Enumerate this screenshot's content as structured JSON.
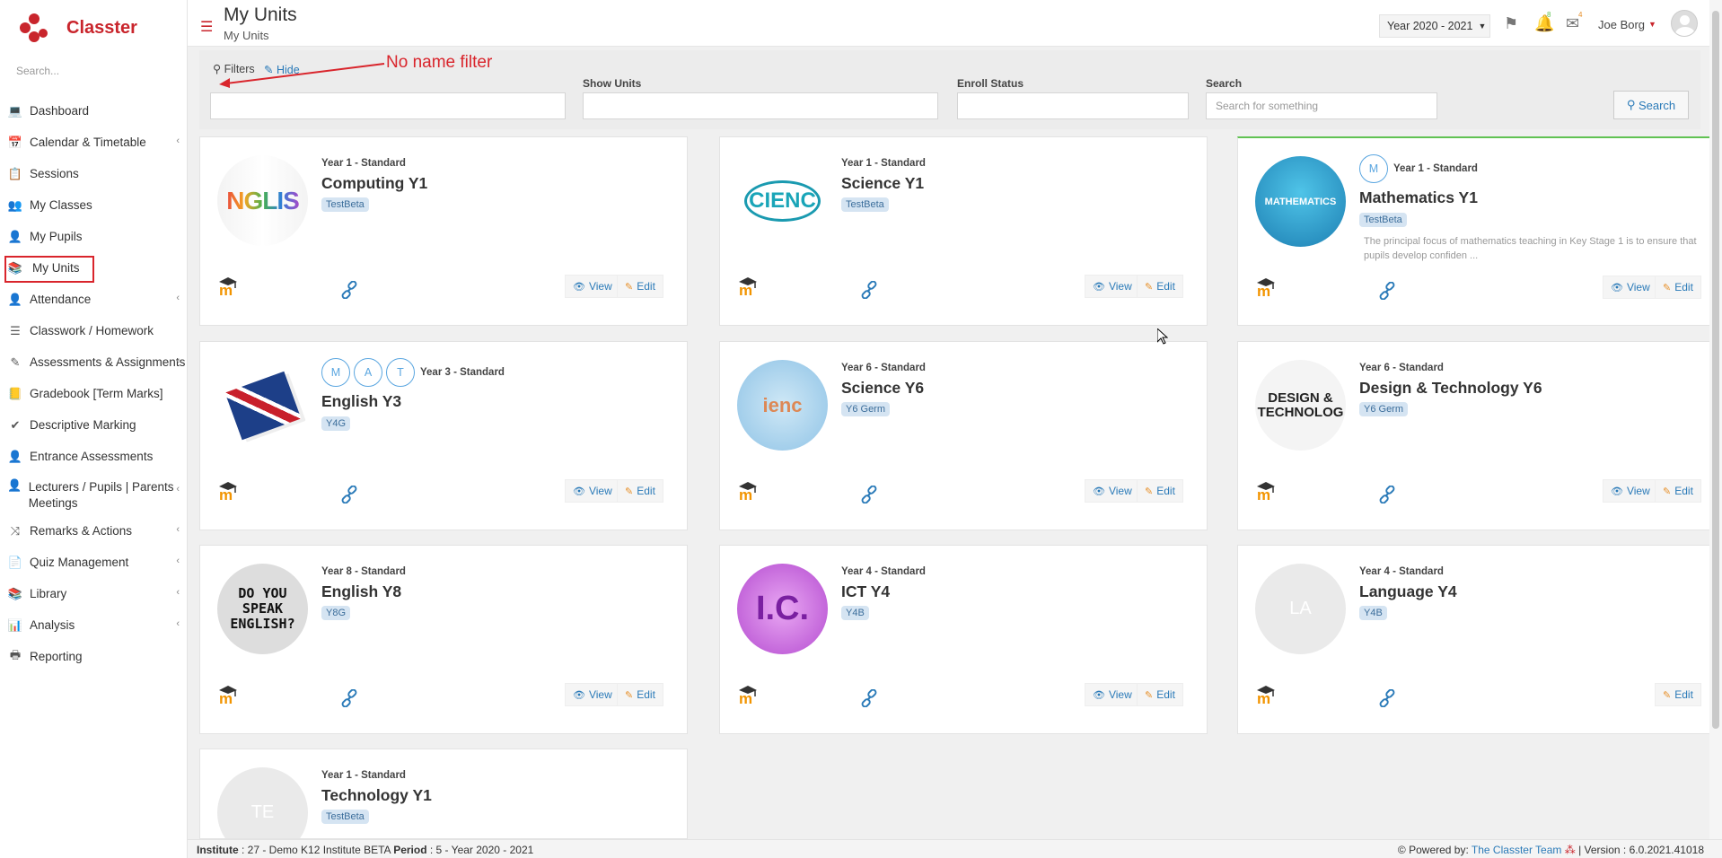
{
  "app": {
    "name": "Classter"
  },
  "sidebar": {
    "search_placeholder": "Search...",
    "items": [
      {
        "label": "Dashboard",
        "icon": "laptop-icon",
        "glyph": "💻",
        "has_arrow": false
      },
      {
        "label": "Calendar & Timetable",
        "icon": "calendar-icon",
        "glyph": "📅",
        "has_arrow": true
      },
      {
        "label": "Sessions",
        "icon": "sessions-icon",
        "glyph": "📋",
        "has_arrow": false
      },
      {
        "label": "My Classes",
        "icon": "classes-icon",
        "glyph": "👥",
        "has_arrow": false
      },
      {
        "label": "My Pupils",
        "icon": "pupils-icon",
        "glyph": "👤",
        "has_arrow": false
      },
      {
        "label": "My Units",
        "icon": "units-icon",
        "glyph": "📚",
        "has_arrow": false,
        "active": true
      },
      {
        "label": "Attendance",
        "icon": "attendance-icon",
        "glyph": "👤",
        "has_arrow": true
      },
      {
        "label": "Classwork / Homework",
        "icon": "list-icon",
        "glyph": "☰",
        "has_arrow": false
      },
      {
        "label": "Assessments & Assignments",
        "icon": "edit-icon",
        "glyph": "✎",
        "has_arrow": true
      },
      {
        "label": "Gradebook [Term Marks]",
        "icon": "gradebook-icon",
        "glyph": "📒",
        "has_arrow": false
      },
      {
        "label": "Descriptive Marking",
        "icon": "marking-icon",
        "glyph": "✔",
        "has_arrow": false
      },
      {
        "label": "Entrance Assessments",
        "icon": "entrance-icon",
        "glyph": "👤",
        "has_arrow": false
      },
      {
        "label": "Lecturers / Pupils | Parents Meetings",
        "icon": "meetings-icon",
        "glyph": "👤",
        "has_arrow": true,
        "two_line": true
      },
      {
        "label": "Remarks & Actions",
        "icon": "remarks-icon",
        "glyph": "⤨",
        "has_arrow": true
      },
      {
        "label": "Quiz Management",
        "icon": "quiz-icon",
        "glyph": "📄",
        "has_arrow": true
      },
      {
        "label": "Library",
        "icon": "library-icon",
        "glyph": "📚",
        "has_arrow": true
      },
      {
        "label": "Analysis",
        "icon": "analysis-icon",
        "glyph": "📊",
        "has_arrow": true
      },
      {
        "label": "Reporting",
        "icon": "printer-icon",
        "glyph": "🖶",
        "has_arrow": false
      }
    ]
  },
  "header": {
    "title": "My Units",
    "breadcrumb": "My Units",
    "year": "Year 2020 - 2021",
    "notifications_count": "8",
    "messages_count": "4",
    "user_name": "Joe Borg"
  },
  "filters": {
    "label": "Filters",
    "hide_label": "Hide",
    "annotation": "No name filter",
    "show_units_label": "Show Units",
    "enroll_status_label": "Enroll Status",
    "search_label": "Search",
    "search_placeholder": "Search for something",
    "search_button": "Search"
  },
  "buttons": {
    "view": "View",
    "edit": "Edit"
  },
  "units": [
    {
      "level": "Year 1 - Standard",
      "title": "Computing Y1",
      "tag": "TestBeta",
      "thumb_text": "NGLIS",
      "thumb_style": "english",
      "has_view": true
    },
    {
      "level": "Year 1 - Standard",
      "title": "Science Y1",
      "tag": "TestBeta",
      "thumb_text": "CIENC",
      "thumb_style": "science",
      "has_view": true
    },
    {
      "level": "Year 1 - Standard",
      "title": "Mathematics Y1",
      "tag": "TestBeta",
      "thumb_text": "MATHEMATICS",
      "thumb_style": "math",
      "has_view": true,
      "circles": [
        "M"
      ],
      "description": "The principal focus of mathematics teaching in Key Stage 1 is to ensure that pupils develop confiden ...",
      "highlight": true
    },
    {
      "level": "Year 3 - Standard",
      "title": "English Y3",
      "tag": "Y4G",
      "thumb_text": "",
      "thumb_style": "book",
      "has_view": true,
      "circles": [
        "M",
        "A",
        "T"
      ]
    },
    {
      "level": "Year 6 - Standard",
      "title": "Science Y6",
      "tag": "Y6 Germ",
      "thumb_text": "ienc",
      "thumb_style": "flasks",
      "has_view": true
    },
    {
      "level": "Year 6 - Standard",
      "title": "Design & Technology Y6",
      "tag": "Y6 Germ",
      "thumb_text": "DESIGN & TECHNOLOG",
      "thumb_style": "design",
      "has_view": true
    },
    {
      "level": "Year 8 - Standard",
      "title": "English Y8",
      "tag": "Y8G",
      "thumb_text": "DO YOU SPEAK ENGLISH?",
      "thumb_style": "speak",
      "has_view": true
    },
    {
      "level": "Year 4 - Standard",
      "title": "ICT Y4",
      "tag": "Y4B",
      "thumb_text": "I.C.",
      "thumb_style": "ict",
      "has_view": true
    },
    {
      "level": "Year 4 - Standard",
      "title": "Language Y4",
      "tag": "Y4B",
      "thumb_text": "LA",
      "thumb_style": "placeholder",
      "has_view": false
    },
    {
      "level": "Year 1 - Standard",
      "title": "Technology Y1",
      "tag": "TestBeta",
      "thumb_text": "TE",
      "thumb_style": "placeholder",
      "has_view": false,
      "partial": true
    }
  ],
  "footer": {
    "institute_label": "Institute",
    "institute_value": " : 27 - Demo K12 Institute BETA ",
    "period_label": "Period",
    "period_value": " : 5 - Year 2020 - 2021",
    "powered_by": "Powered by:",
    "team": "The Classter Team",
    "version": " | Version : 6.0.2021.41018"
  },
  "colors": {
    "brand": "#c9252c",
    "link": "#2a7ab8",
    "tag_bg": "#d5e4f2",
    "highlight": "#61c253"
  }
}
